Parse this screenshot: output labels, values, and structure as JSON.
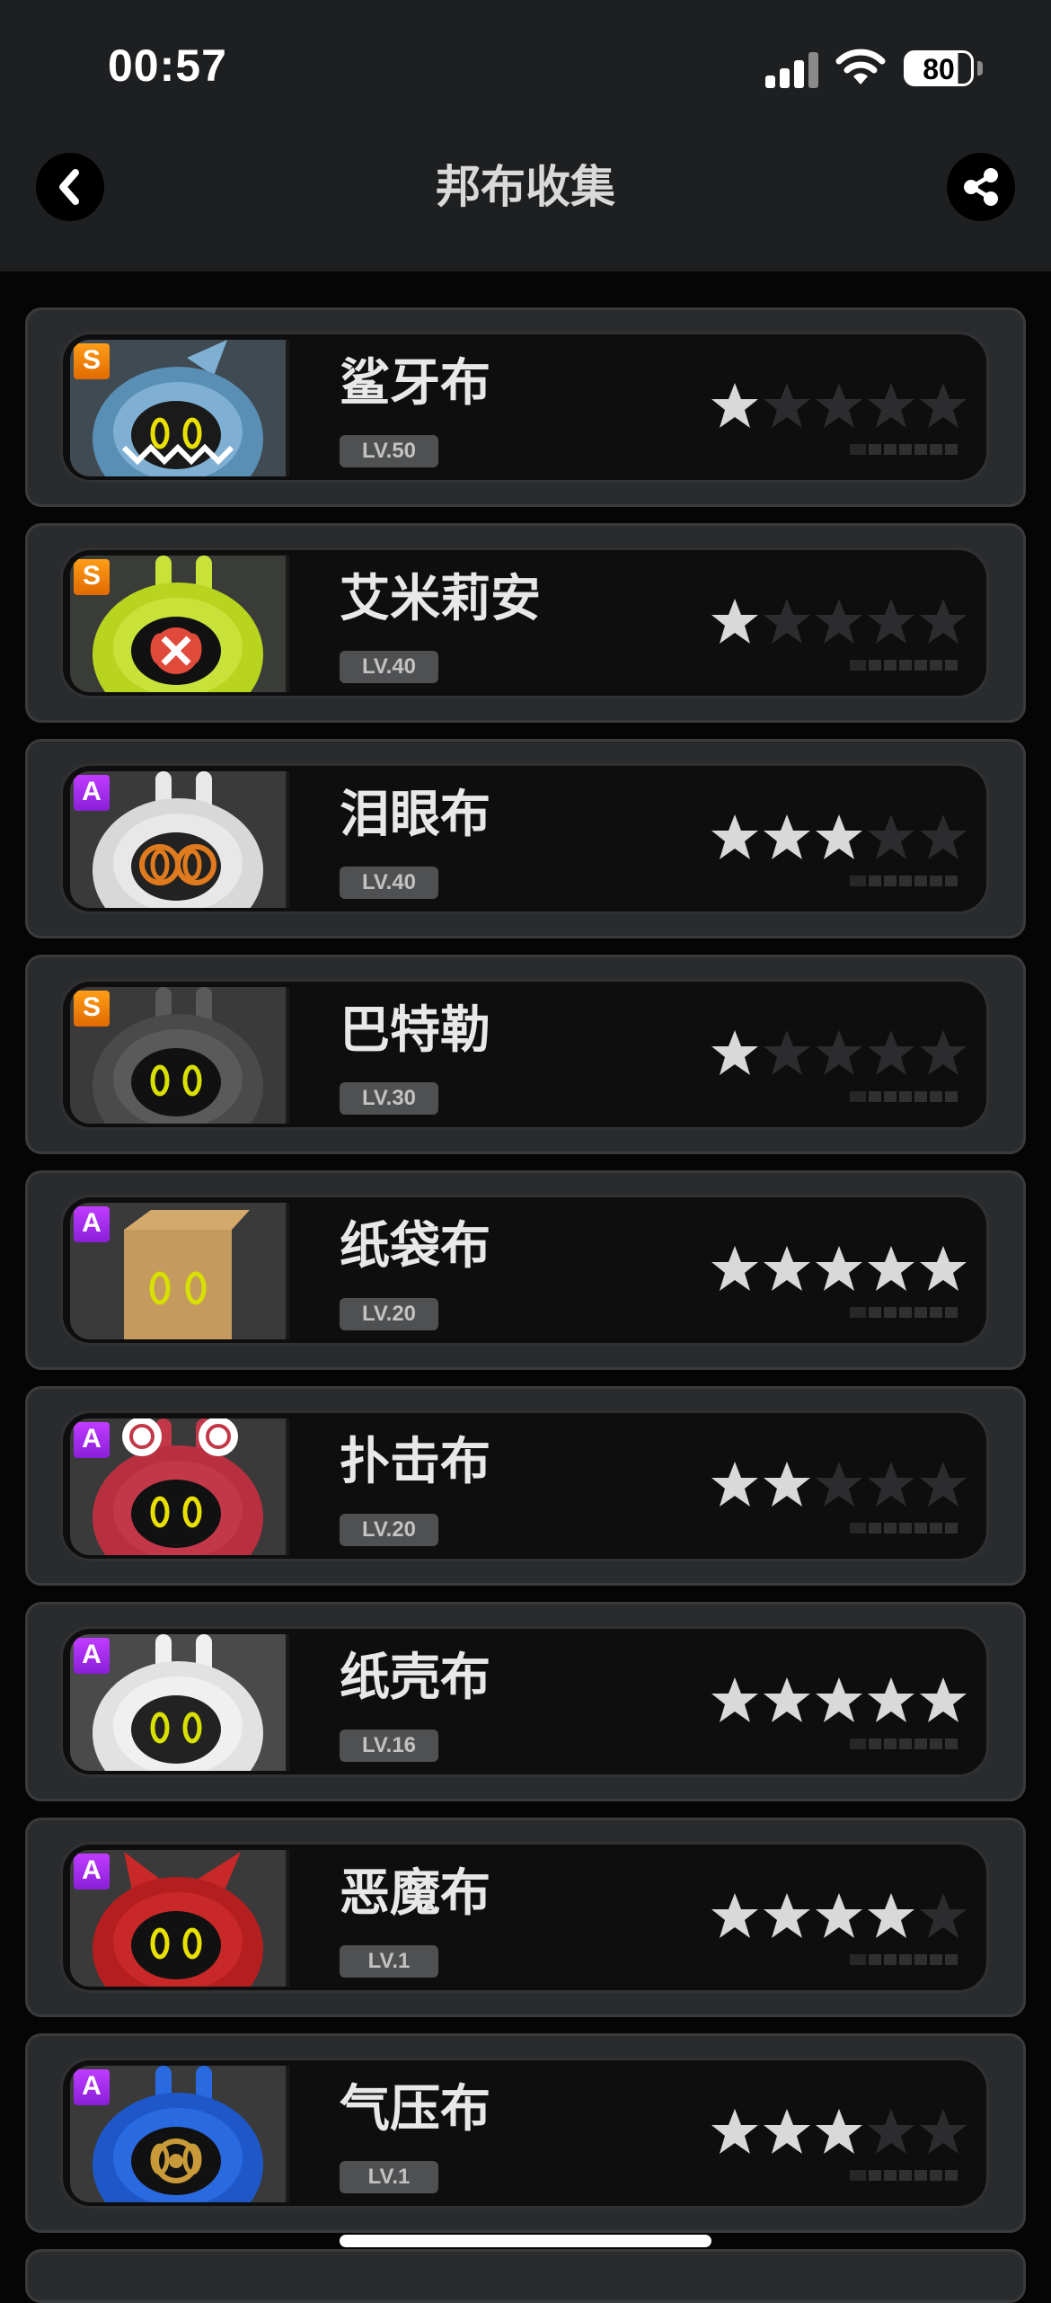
{
  "status_bar": {
    "time": "00:57",
    "battery": "80"
  },
  "header": {
    "title": "邦布收集"
  },
  "colors": {
    "star_filled": "#d9d9d9",
    "star_empty": "#2c2c2e",
    "rank_s": "#f58a0c",
    "rank_a": "#a62ef0"
  },
  "bangboo": [
    {
      "name": "鲨牙布",
      "level": "LV.50",
      "rank": "S",
      "stars": 1,
      "icon": "shark-bangboo-icon"
    },
    {
      "name": "艾米莉安",
      "level": "LV.40",
      "rank": "S",
      "stars": 1,
      "icon": "green-rabbit-bangboo-icon"
    },
    {
      "name": "泪眼布",
      "level": "LV.40",
      "rank": "A",
      "stars": 3,
      "icon": "goggles-bangboo-icon"
    },
    {
      "name": "巴特勒",
      "level": "LV.30",
      "rank": "S",
      "stars": 1,
      "icon": "butler-bangboo-icon"
    },
    {
      "name": "纸袋布",
      "level": "LV.20",
      "rank": "A",
      "stars": 5,
      "icon": "paper-bag-bangboo-icon"
    },
    {
      "name": "扑击布",
      "level": "LV.20",
      "rank": "A",
      "stars": 2,
      "icon": "spiral-bangboo-icon"
    },
    {
      "name": "纸壳布",
      "level": "LV.16",
      "rank": "A",
      "stars": 5,
      "icon": "cardboard-bangboo-icon"
    },
    {
      "name": "恶魔布",
      "level": "LV.1",
      "rank": "A",
      "stars": 4,
      "icon": "devil-bangboo-icon"
    },
    {
      "name": "气压布",
      "level": "LV.1",
      "rank": "A",
      "stars": 3,
      "icon": "pressure-bangboo-icon"
    }
  ]
}
